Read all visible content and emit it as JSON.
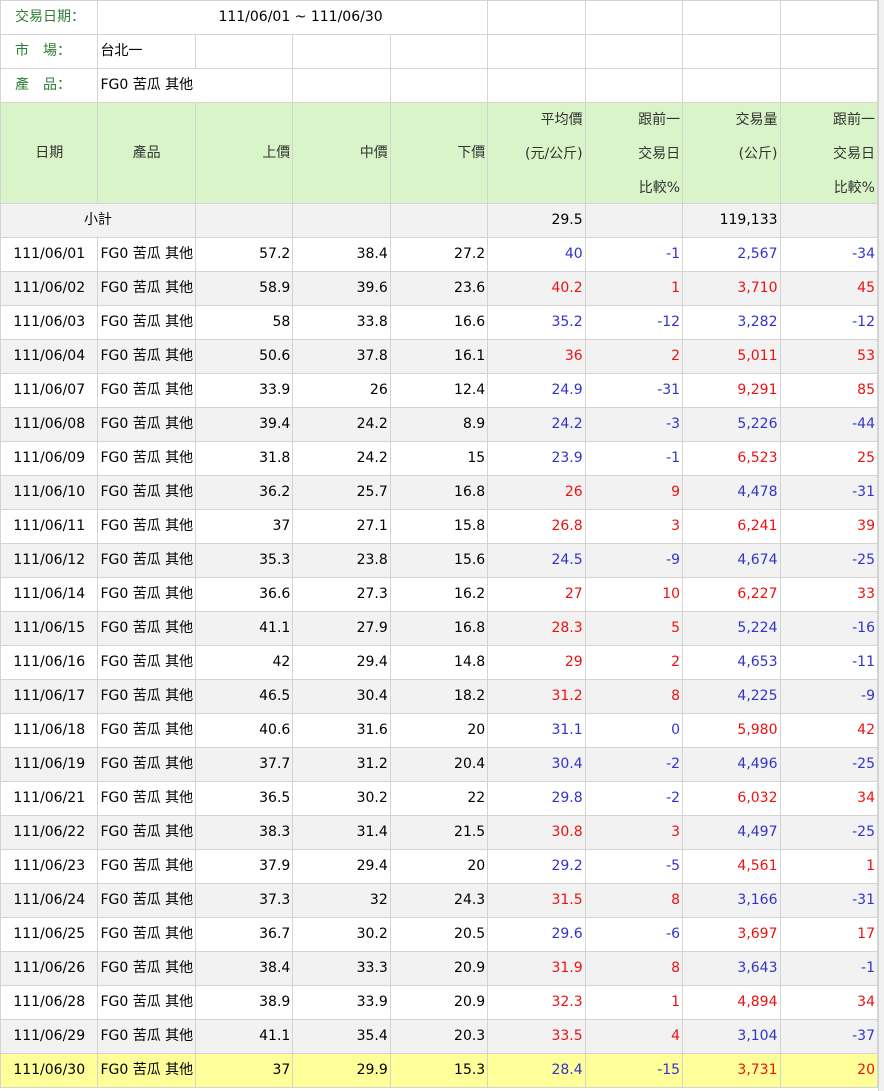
{
  "info": {
    "date_label": "交易日期：",
    "date_value": "111/06/01 ~ 111/06/30",
    "market_label": "市　場：",
    "market_value": "台北一",
    "product_label": "產　品：",
    "product_value": "FG0 苦瓜 其他"
  },
  "header": {
    "date": "日期",
    "product": "產品",
    "high": "上價",
    "mid": "中價",
    "low": "下價",
    "avg_l1": "平均價",
    "avg_l2": "(元/公斤)",
    "avgcmp_l1": "跟前一",
    "avgcmp_l2": "交易日",
    "avgcmp_l3": "比較%",
    "vol_l1": "交易量",
    "vol_l2": "(公斤)",
    "volcmp_l1": "跟前一",
    "volcmp_l2": "交易日",
    "volcmp_l3": "比較%"
  },
  "subtotal": {
    "label": "小計",
    "avg": "29.5",
    "volume": "119,133"
  },
  "colors": {
    "up": "#ee1111",
    "down": "#3333cc",
    "header_bg": "#d9f4c8",
    "highlight_bg": "#ffff99"
  },
  "rows": [
    {
      "date": "111/06/01",
      "product": "FG0 苦瓜 其他",
      "high": "57.2",
      "mid": "38.4",
      "low": "27.2",
      "avg": "40",
      "avg_color": "blue",
      "avg_chg": "-1",
      "avg_chg_color": "blue",
      "vol": "2,567",
      "vol_color": "blue",
      "vol_chg": "-34",
      "vol_chg_color": "blue"
    },
    {
      "date": "111/06/02",
      "product": "FG0 苦瓜 其他",
      "high": "58.9",
      "mid": "39.6",
      "low": "23.6",
      "avg": "40.2",
      "avg_color": "red",
      "avg_chg": "1",
      "avg_chg_color": "red",
      "vol": "3,710",
      "vol_color": "red",
      "vol_chg": "45",
      "vol_chg_color": "red"
    },
    {
      "date": "111/06/03",
      "product": "FG0 苦瓜 其他",
      "high": "58",
      "mid": "33.8",
      "low": "16.6",
      "avg": "35.2",
      "avg_color": "blue",
      "avg_chg": "-12",
      "avg_chg_color": "blue",
      "vol": "3,282",
      "vol_color": "blue",
      "vol_chg": "-12",
      "vol_chg_color": "blue"
    },
    {
      "date": "111/06/04",
      "product": "FG0 苦瓜 其他",
      "high": "50.6",
      "mid": "37.8",
      "low": "16.1",
      "avg": "36",
      "avg_color": "red",
      "avg_chg": "2",
      "avg_chg_color": "red",
      "vol": "5,011",
      "vol_color": "red",
      "vol_chg": "53",
      "vol_chg_color": "red"
    },
    {
      "date": "111/06/07",
      "product": "FG0 苦瓜 其他",
      "high": "33.9",
      "mid": "26",
      "low": "12.4",
      "avg": "24.9",
      "avg_color": "blue",
      "avg_chg": "-31",
      "avg_chg_color": "blue",
      "vol": "9,291",
      "vol_color": "red",
      "vol_chg": "85",
      "vol_chg_color": "red"
    },
    {
      "date": "111/06/08",
      "product": "FG0 苦瓜 其他",
      "high": "39.4",
      "mid": "24.2",
      "low": "8.9",
      "avg": "24.2",
      "avg_color": "blue",
      "avg_chg": "-3",
      "avg_chg_color": "blue",
      "vol": "5,226",
      "vol_color": "blue",
      "vol_chg": "-44",
      "vol_chg_color": "blue"
    },
    {
      "date": "111/06/09",
      "product": "FG0 苦瓜 其他",
      "high": "31.8",
      "mid": "24.2",
      "low": "15",
      "avg": "23.9",
      "avg_color": "blue",
      "avg_chg": "-1",
      "avg_chg_color": "blue",
      "vol": "6,523",
      "vol_color": "red",
      "vol_chg": "25",
      "vol_chg_color": "red"
    },
    {
      "date": "111/06/10",
      "product": "FG0 苦瓜 其他",
      "high": "36.2",
      "mid": "25.7",
      "low": "16.8",
      "avg": "26",
      "avg_color": "red",
      "avg_chg": "9",
      "avg_chg_color": "red",
      "vol": "4,478",
      "vol_color": "blue",
      "vol_chg": "-31",
      "vol_chg_color": "blue"
    },
    {
      "date": "111/06/11",
      "product": "FG0 苦瓜 其他",
      "high": "37",
      "mid": "27.1",
      "low": "15.8",
      "avg": "26.8",
      "avg_color": "red",
      "avg_chg": "3",
      "avg_chg_color": "red",
      "vol": "6,241",
      "vol_color": "red",
      "vol_chg": "39",
      "vol_chg_color": "red"
    },
    {
      "date": "111/06/12",
      "product": "FG0 苦瓜 其他",
      "high": "35.3",
      "mid": "23.8",
      "low": "15.6",
      "avg": "24.5",
      "avg_color": "blue",
      "avg_chg": "-9",
      "avg_chg_color": "blue",
      "vol": "4,674",
      "vol_color": "blue",
      "vol_chg": "-25",
      "vol_chg_color": "blue"
    },
    {
      "date": "111/06/14",
      "product": "FG0 苦瓜 其他",
      "high": "36.6",
      "mid": "27.3",
      "low": "16.2",
      "avg": "27",
      "avg_color": "red",
      "avg_chg": "10",
      "avg_chg_color": "red",
      "vol": "6,227",
      "vol_color": "red",
      "vol_chg": "33",
      "vol_chg_color": "red"
    },
    {
      "date": "111/06/15",
      "product": "FG0 苦瓜 其他",
      "high": "41.1",
      "mid": "27.9",
      "low": "16.8",
      "avg": "28.3",
      "avg_color": "red",
      "avg_chg": "5",
      "avg_chg_color": "red",
      "vol": "5,224",
      "vol_color": "blue",
      "vol_chg": "-16",
      "vol_chg_color": "blue"
    },
    {
      "date": "111/06/16",
      "product": "FG0 苦瓜 其他",
      "high": "42",
      "mid": "29.4",
      "low": "14.8",
      "avg": "29",
      "avg_color": "red",
      "avg_chg": "2",
      "avg_chg_color": "red",
      "vol": "4,653",
      "vol_color": "blue",
      "vol_chg": "-11",
      "vol_chg_color": "blue"
    },
    {
      "date": "111/06/17",
      "product": "FG0 苦瓜 其他",
      "high": "46.5",
      "mid": "30.4",
      "low": "18.2",
      "avg": "31.2",
      "avg_color": "red",
      "avg_chg": "8",
      "avg_chg_color": "red",
      "vol": "4,225",
      "vol_color": "blue",
      "vol_chg": "-9",
      "vol_chg_color": "blue"
    },
    {
      "date": "111/06/18",
      "product": "FG0 苦瓜 其他",
      "high": "40.6",
      "mid": "31.6",
      "low": "20",
      "avg": "31.1",
      "avg_color": "blue",
      "avg_chg": "0",
      "avg_chg_color": "blue",
      "vol": "5,980",
      "vol_color": "red",
      "vol_chg": "42",
      "vol_chg_color": "red"
    },
    {
      "date": "111/06/19",
      "product": "FG0 苦瓜 其他",
      "high": "37.7",
      "mid": "31.2",
      "low": "20.4",
      "avg": "30.4",
      "avg_color": "blue",
      "avg_chg": "-2",
      "avg_chg_color": "blue",
      "vol": "4,496",
      "vol_color": "blue",
      "vol_chg": "-25",
      "vol_chg_color": "blue"
    },
    {
      "date": "111/06/21",
      "product": "FG0 苦瓜 其他",
      "high": "36.5",
      "mid": "30.2",
      "low": "22",
      "avg": "29.8",
      "avg_color": "blue",
      "avg_chg": "-2",
      "avg_chg_color": "blue",
      "vol": "6,032",
      "vol_color": "red",
      "vol_chg": "34",
      "vol_chg_color": "red"
    },
    {
      "date": "111/06/22",
      "product": "FG0 苦瓜 其他",
      "high": "38.3",
      "mid": "31.4",
      "low": "21.5",
      "avg": "30.8",
      "avg_color": "red",
      "avg_chg": "3",
      "avg_chg_color": "red",
      "vol": "4,497",
      "vol_color": "blue",
      "vol_chg": "-25",
      "vol_chg_color": "blue"
    },
    {
      "date": "111/06/23",
      "product": "FG0 苦瓜 其他",
      "high": "37.9",
      "mid": "29.4",
      "low": "20",
      "avg": "29.2",
      "avg_color": "blue",
      "avg_chg": "-5",
      "avg_chg_color": "blue",
      "vol": "4,561",
      "vol_color": "red",
      "vol_chg": "1",
      "vol_chg_color": "red"
    },
    {
      "date": "111/06/24",
      "product": "FG0 苦瓜 其他",
      "high": "37.3",
      "mid": "32",
      "low": "24.3",
      "avg": "31.5",
      "avg_color": "red",
      "avg_chg": "8",
      "avg_chg_color": "red",
      "vol": "3,166",
      "vol_color": "blue",
      "vol_chg": "-31",
      "vol_chg_color": "blue"
    },
    {
      "date": "111/06/25",
      "product": "FG0 苦瓜 其他",
      "high": "36.7",
      "mid": "30.2",
      "low": "20.5",
      "avg": "29.6",
      "avg_color": "blue",
      "avg_chg": "-6",
      "avg_chg_color": "blue",
      "vol": "3,697",
      "vol_color": "red",
      "vol_chg": "17",
      "vol_chg_color": "red"
    },
    {
      "date": "111/06/26",
      "product": "FG0 苦瓜 其他",
      "high": "38.4",
      "mid": "33.3",
      "low": "20.9",
      "avg": "31.9",
      "avg_color": "red",
      "avg_chg": "8",
      "avg_chg_color": "red",
      "vol": "3,643",
      "vol_color": "blue",
      "vol_chg": "-1",
      "vol_chg_color": "blue"
    },
    {
      "date": "111/06/28",
      "product": "FG0 苦瓜 其他",
      "high": "38.9",
      "mid": "33.9",
      "low": "20.9",
      "avg": "32.3",
      "avg_color": "red",
      "avg_chg": "1",
      "avg_chg_color": "red",
      "vol": "4,894",
      "vol_color": "red",
      "vol_chg": "34",
      "vol_chg_color": "red"
    },
    {
      "date": "111/06/29",
      "product": "FG0 苦瓜 其他",
      "high": "41.1",
      "mid": "35.4",
      "low": "20.3",
      "avg": "33.5",
      "avg_color": "red",
      "avg_chg": "4",
      "avg_chg_color": "red",
      "vol": "3,104",
      "vol_color": "blue",
      "vol_chg": "-37",
      "vol_chg_color": "blue"
    },
    {
      "date": "111/06/30",
      "product": "FG0 苦瓜 其他",
      "high": "37",
      "mid": "29.9",
      "low": "15.3",
      "avg": "28.4",
      "avg_color": "blue",
      "avg_chg": "-15",
      "avg_chg_color": "blue",
      "vol": "3,731",
      "vol_color": "red",
      "vol_chg": "20",
      "vol_chg_color": "red",
      "highlight": true
    }
  ]
}
